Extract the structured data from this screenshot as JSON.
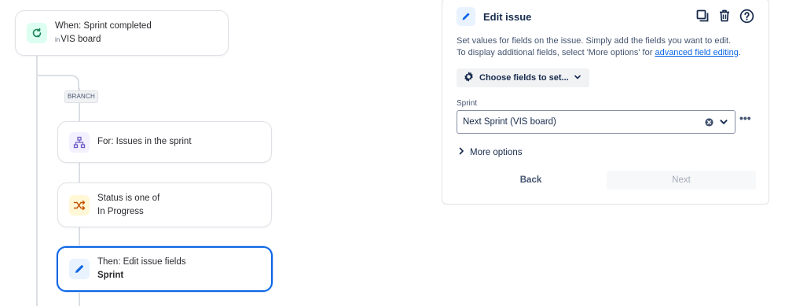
{
  "flow": {
    "trigger": {
      "title": "When: Sprint completed",
      "sub_prefix": "in",
      "sub": "VIS board"
    },
    "branch_label": "BRANCH",
    "for_each": {
      "title": "For: Issues in the sprint"
    },
    "condition": {
      "title": "Status is one of",
      "value": "In Progress"
    },
    "action": {
      "title": "Then: Edit issue fields",
      "value": "Sprint"
    }
  },
  "panel": {
    "title": "Edit issue",
    "description_line1": "Set values for fields on the issue. Simply add the fields you want to edit.",
    "description_line2_prefix": "To display additional fields, select 'More options' for ",
    "description_link": "advanced field editing",
    "description_line2_suffix": ".",
    "choose_fields_label": "Choose fields to set...",
    "sprint_field_label": "Sprint",
    "sprint_field_value": "Next Sprint (VIS board)",
    "more_dots": "•••",
    "more_options_label": "More options",
    "back_label": "Back",
    "next_label": "Next"
  },
  "colors": {
    "accent": "#0c66e4",
    "trigger_icon_bg": "#dcfff1",
    "branch_icon_bg": "#f3f0ff",
    "condition_icon_bg": "#fff7d6",
    "action_icon_bg": "#e9f2ff"
  },
  "icons": {
    "trigger": "refresh-icon",
    "for_each": "hierarchy-icon",
    "condition": "shuffle-icon",
    "action": "pencil-icon",
    "duplicate": "copy-icon",
    "delete": "trash-icon",
    "help": "help-icon"
  }
}
